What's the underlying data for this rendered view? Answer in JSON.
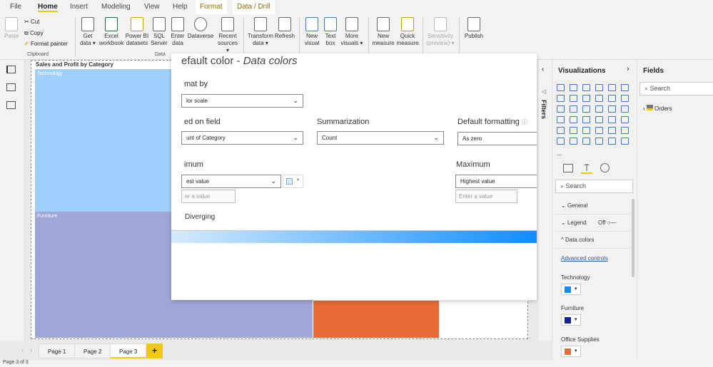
{
  "tabs": [
    "File",
    "Home",
    "Insert",
    "Modeling",
    "View",
    "Help",
    "Format",
    "Data / Drill"
  ],
  "ribbon": {
    "clipboard": {
      "paste": "Paste",
      "cut": "Cut",
      "copy": "Copy",
      "format_painter": "Format painter",
      "group": "Clipboard"
    },
    "data": [
      [
        "Get",
        "data ▾"
      ],
      [
        "Excel",
        "workbook"
      ],
      [
        "Power BI",
        "datasets"
      ],
      [
        "SQL",
        "Server"
      ],
      [
        "Enter",
        "data"
      ],
      [
        "Dataverse",
        ""
      ],
      [
        "Recent",
        "sources ▾"
      ]
    ],
    "data_group": "Data",
    "queries": [
      [
        "Transform",
        "data ▾"
      ],
      [
        "Refresh",
        ""
      ]
    ],
    "insert": [
      [
        "New",
        "visual"
      ],
      [
        "Text",
        "box"
      ],
      [
        "More",
        "visuals ▾"
      ]
    ],
    "calc": [
      [
        "New",
        "measure"
      ],
      [
        "Quick",
        "measure"
      ]
    ],
    "sensitivity": [
      "Sensitivity",
      "(preview) ▾"
    ],
    "publish": "Publish"
  },
  "visual": {
    "title": "Sales and Profit by Category",
    "tiles": [
      {
        "label": "Technology",
        "color": "#9fd0fb"
      },
      {
        "label": "Furniture",
        "color": "#a0a6d8"
      },
      {
        "label": "",
        "color": "#e86a35"
      }
    ]
  },
  "dialog": {
    "title": "efault color - ",
    "title_italic": "Data colors",
    "format_by_label": "mat by",
    "format_by_value": "lor scale",
    "based_on_label": "ed on field",
    "based_on_value": "unt of Category",
    "summarization_label": "Summarization",
    "summarization_value": "Count",
    "default_formatting_label": "Default formatting",
    "default_formatting_value": "As zero",
    "minimum_label": "imum",
    "minimum_value": "est value",
    "minimum_placeholder": "er a value",
    "maximum_label": "Maximum",
    "maximum_value": "Highest value",
    "maximum_placeholder": "Enter a value",
    "diverging_label": "Diverging",
    "gradient": [
      "#d6ebfd",
      "#118dff"
    ]
  },
  "filters_label": "Filters",
  "viz": {
    "title": "Visualizations",
    "search_placeholder": "Search",
    "more": "...",
    "sections": {
      "general": "General",
      "legend": "Legend",
      "legend_state": "Off",
      "data_colors": "Data colors"
    },
    "advanced": "Advanced controls",
    "colors": [
      {
        "label": "Technology",
        "color": "#118dff"
      },
      {
        "label": "Furniture",
        "color": "#12239e"
      },
      {
        "label": "Office Supplies",
        "color": "#e66c37"
      }
    ]
  },
  "fields": {
    "title": "Fields",
    "search_placeholder": "Search",
    "tables": [
      "Orders"
    ]
  },
  "pages": [
    "Page 1",
    "Page 2",
    "Page 3"
  ],
  "add_page": "+",
  "status": "Page 3 of 3"
}
